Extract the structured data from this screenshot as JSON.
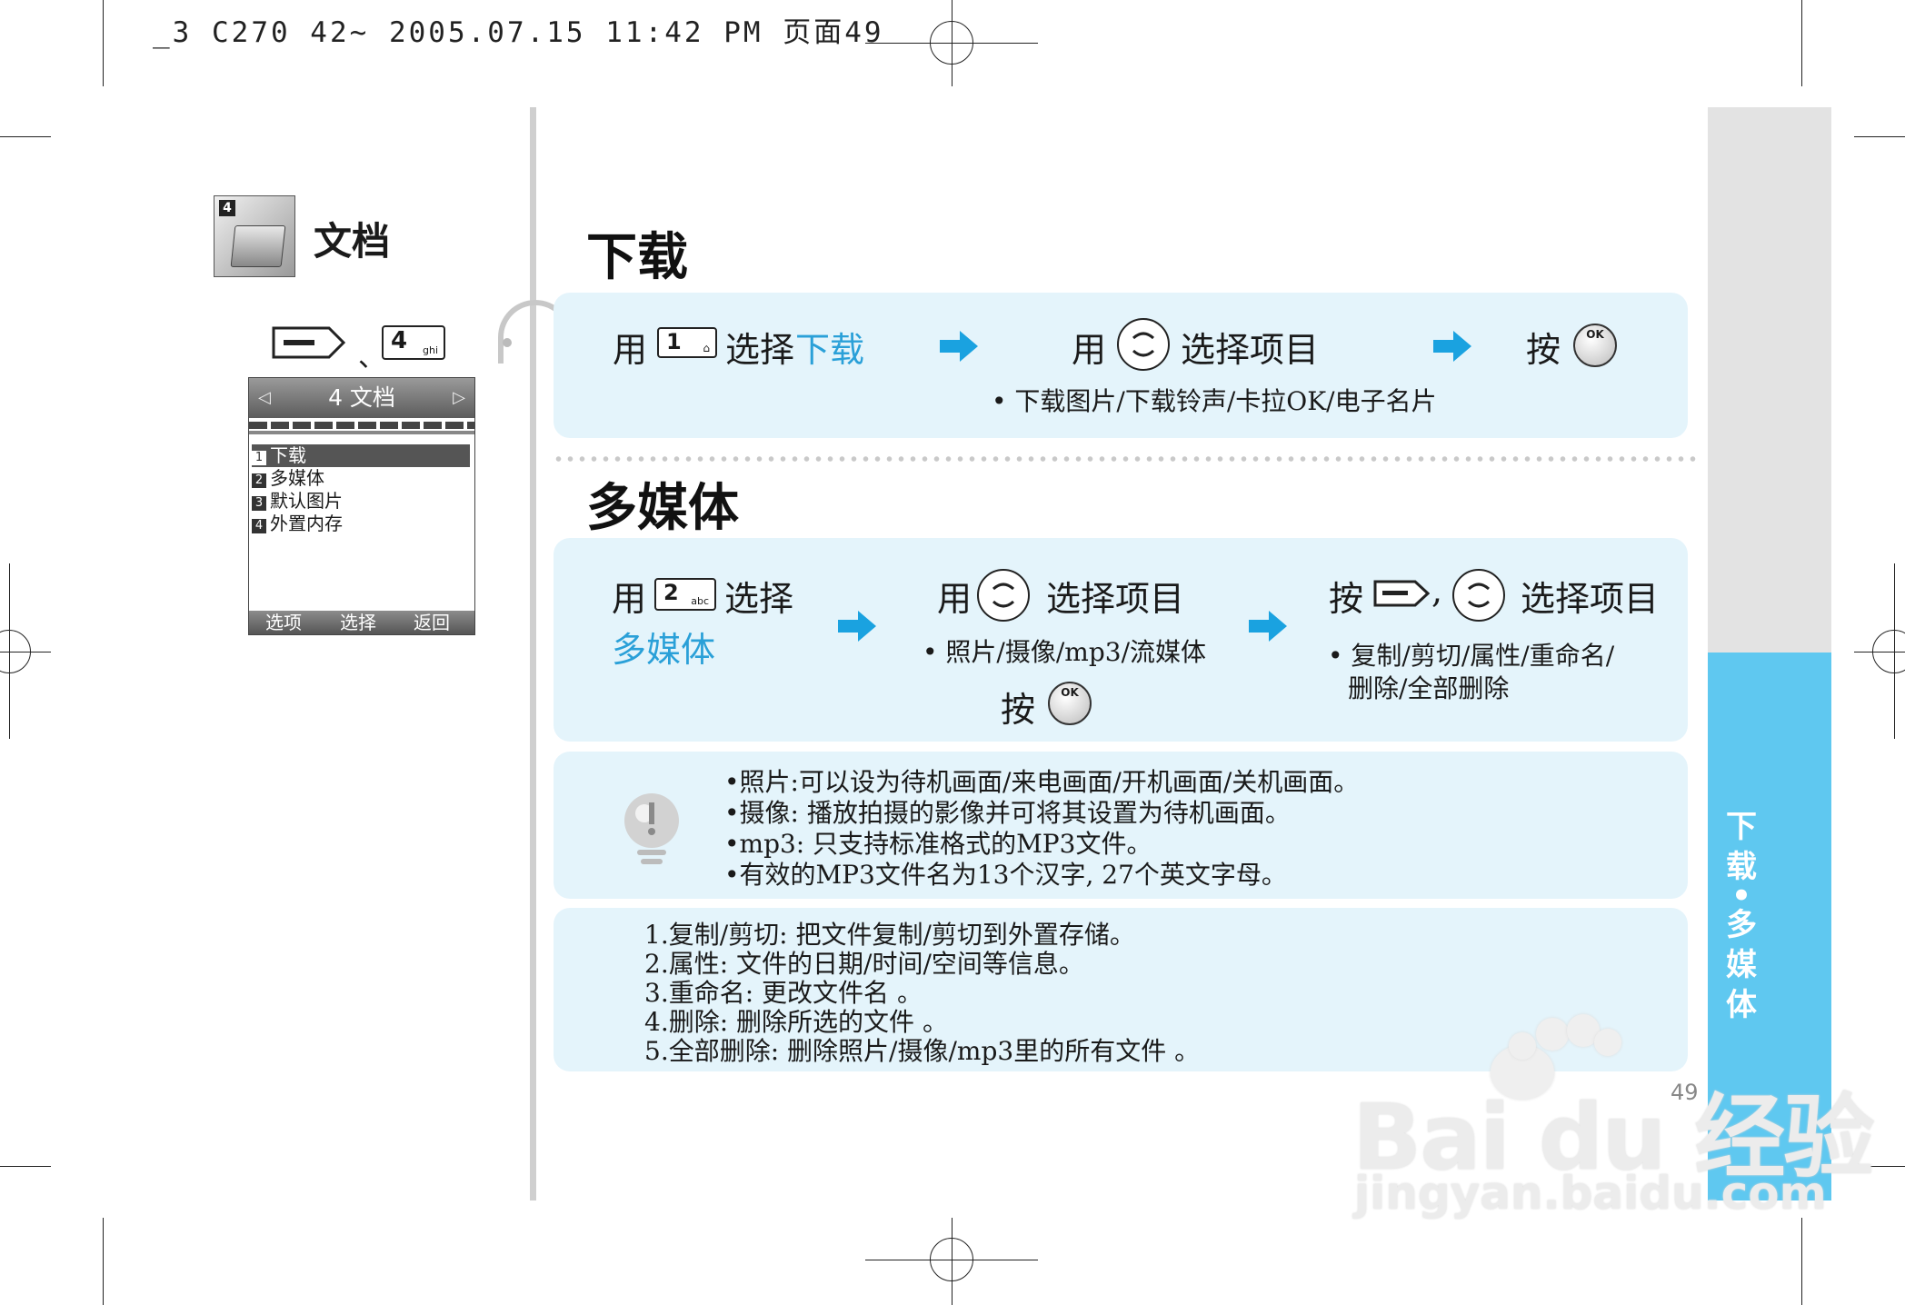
{
  "print_header": "_3 C270 42~ 2005.07.15 11:42 PM 页面49",
  "left": {
    "icon_num": "4",
    "title": "文档",
    "separator": "、",
    "key4_num": "4",
    "key4_letters": "ghi",
    "phone": {
      "header": "4 文档",
      "items": [
        {
          "n": "1",
          "label": "下载"
        },
        {
          "n": "2",
          "label": "多媒体"
        },
        {
          "n": "3",
          "label": "默认图片"
        },
        {
          "n": "4",
          "label": "外置内存"
        }
      ],
      "soft_left": "选项",
      "soft_mid": "选择",
      "soft_right": "返回"
    }
  },
  "download": {
    "title": "下载",
    "step1_use": "用",
    "step1_key": "1",
    "step1_select": "选择",
    "step1_target": "下载",
    "step2_use": "用",
    "step2_text": "选择项目",
    "step3_press": "按",
    "ok_label": "OK",
    "bullet": "下载图片/下载铃声/卡拉OK/电子名片"
  },
  "multimedia": {
    "title": "多媒体",
    "step1_use": "用",
    "step1_key": "2",
    "step1_key_letters": "abc",
    "step1_select": "选择",
    "step1_target": "多媒体",
    "step2_use": "用",
    "step2_text": "选择项目",
    "step2_bullet": "照片/摄像/mp3/流媒体",
    "step2_press": "按",
    "step3_press": "按",
    "step3_comma": ",",
    "step3_text": "选择项目",
    "step3_bullet_1": "复制/剪切/属性/重命名/",
    "step3_bullet_2": "删除/全部删除",
    "ok_label": "OK"
  },
  "notes": [
    "照片:可以设为待机画面/来电画面/开机画面/关机画面。",
    "摄像:  播放拍摄的影像并可将其设置为待机画面。",
    "mp3:  只支持标准格式的MP3文件。",
    "有效的MP3文件名为13个汉字, 27个英文字母。"
  ],
  "definitions": [
    "1.复制/剪切:  把文件复制/剪切到外置存储。",
    "2.属性:  文件的日期/时间/空间等信息。",
    "3.重命名:  更改文件名 。",
    "4.删除:  删除所选的文件 。",
    "5.全部删除:  删除照片/摄像/mp3里的所有文件 。"
  ],
  "side_tab": [
    "下",
    "载",
    "•",
    "多",
    "媒",
    "体"
  ],
  "page_number": "49",
  "watermark": {
    "brand": "Bai du 经验",
    "url": "jingyan.baidu.com"
  },
  "colors": {
    "accent": "#2aa0d8",
    "panel": "#e4f4fb",
    "side_tab": "#5fc8f0"
  }
}
